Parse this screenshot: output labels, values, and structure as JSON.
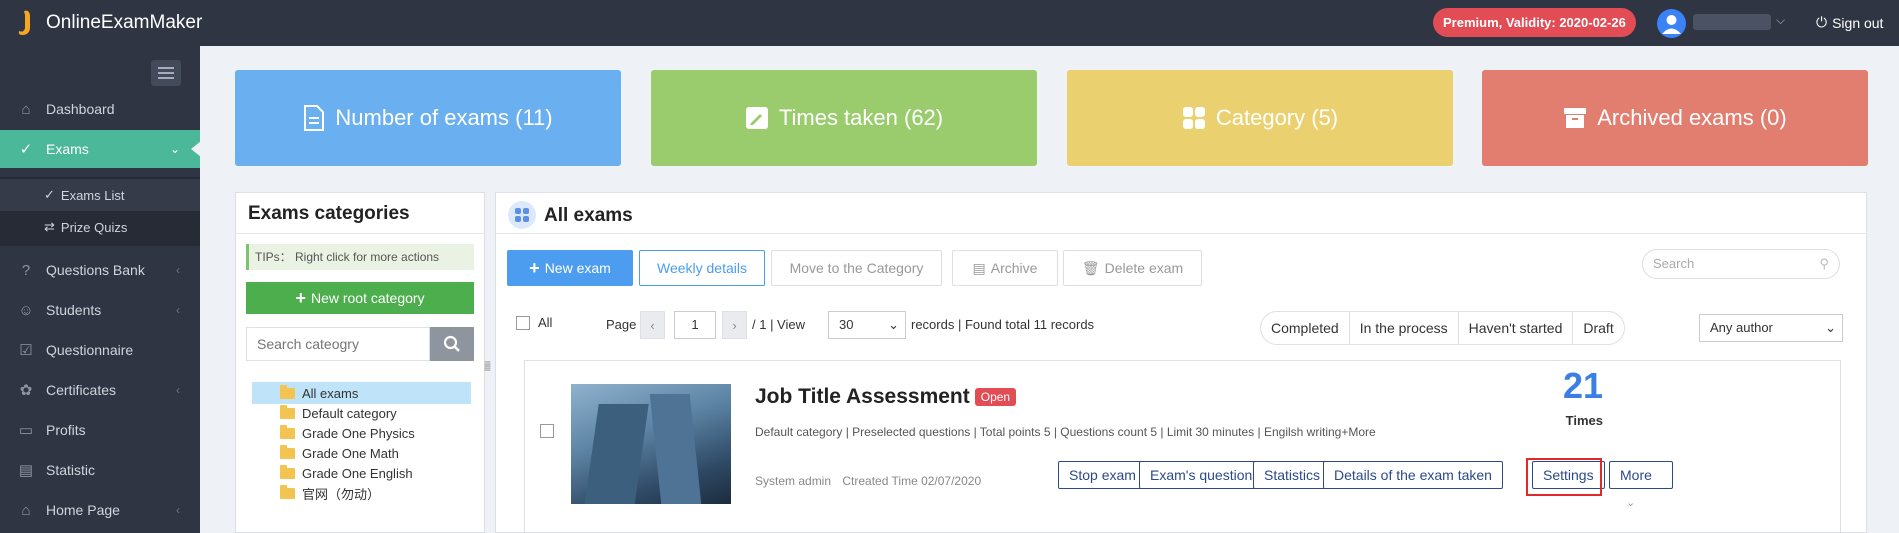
{
  "app": {
    "logo_text": "OnlineExamMaker"
  },
  "header": {
    "premium_label": "Premium, Validity: 2020-02-26",
    "signout_label": "Sign out"
  },
  "sidebar": {
    "items": [
      {
        "label": "Dashboard",
        "icon": "home-icon"
      },
      {
        "label": "Exams",
        "icon": "check-circle-icon",
        "active": true
      },
      {
        "label": "Questions Bank",
        "icon": "question-circle-icon"
      },
      {
        "label": "Students",
        "icon": "users-icon"
      },
      {
        "label": "Questionnaire",
        "icon": "checkbox-icon"
      },
      {
        "label": "Certificates",
        "icon": "certificate-icon"
      },
      {
        "label": "Profits",
        "icon": "card-icon"
      },
      {
        "label": "Statistic",
        "icon": "bar-chart-icon"
      },
      {
        "label": "Home Page",
        "icon": "home-page-icon"
      }
    ],
    "subitems": [
      {
        "label": "Exams List",
        "selected": true
      },
      {
        "label": "Prize Quizs"
      }
    ]
  },
  "stats": [
    {
      "label": "Number of exams (11)",
      "color": "#6aaff0"
    },
    {
      "label": "Times taken (62)",
      "color": "#9acc6e"
    },
    {
      "label": "Category (5)",
      "color": "#ebd06f"
    },
    {
      "label": "Archived exams (0)",
      "color": "#e27e6f"
    }
  ],
  "categories": {
    "title": "Exams categories",
    "tips": "TIPs： Right click for more actions",
    "new_root_label": "New root category",
    "search_placeholder": "Search cateogry",
    "tree": [
      "All exams",
      "Default category",
      "Grade One Physics",
      "Grade One Math",
      "Grade One English",
      "官网（勿动）"
    ]
  },
  "main": {
    "title": "All exams",
    "toolbar": {
      "new_exam": "New exam",
      "weekly_details": "Weekly details",
      "move_category": "Move to the Category",
      "archive": "Archive",
      "delete_exam": "Delete exam",
      "search_placeholder": "Search"
    },
    "pager": {
      "all_label": "All",
      "page_label": "Page",
      "page_value": "1",
      "total_pages": "/ 1 | View",
      "view_value": "30",
      "records_text": "records | Found total 11 records"
    },
    "filters": [
      "Completed",
      "In the process",
      "Haven't started",
      "Draft"
    ],
    "author_select": "Any author"
  },
  "exam": {
    "name": "Job Title Assessment",
    "status": "Open",
    "meta": "Default category | Preselected questions | Total points 5 | Questions count 5 | Limit 30 minutes | Engilsh writing+More",
    "author": "System admin",
    "created": "Ctreated Time 02/07/2020",
    "times_count": "21",
    "times_label": "Times",
    "actions": [
      "Stop exam",
      "Exam's questions",
      "Statistics",
      "Details of the exam taken",
      "Settings",
      "More"
    ]
  }
}
